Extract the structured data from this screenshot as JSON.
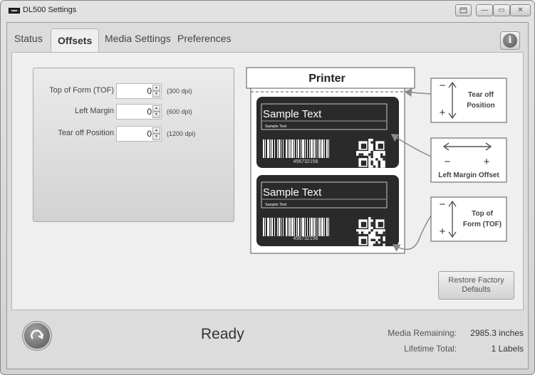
{
  "window": {
    "title": "DL500 Settings",
    "controls": {
      "minimize": "—",
      "maximize": "▭",
      "close": "✕"
    }
  },
  "tabs": [
    {
      "label": "Status",
      "active": false
    },
    {
      "label": "Offsets",
      "active": true
    },
    {
      "label": "Media Settings",
      "active": false
    },
    {
      "label": "Preferences",
      "active": false
    }
  ],
  "info_button": {
    "icon": "info-icon",
    "glyph": "i"
  },
  "offsets": {
    "fields": [
      {
        "label": "Top of Form (TOF)",
        "value": "0",
        "note": "(300 dpi)"
      },
      {
        "label": "Left Margin",
        "value": "0",
        "note": "(600 dpi)"
      },
      {
        "label": "Tear off Position",
        "value": "0",
        "note": "(1200 dpi)"
      }
    ]
  },
  "illustration": {
    "printer_label": "Printer",
    "labels": [
      {
        "title": "Sample Text",
        "subtitle": "Sample Text",
        "barcode_number": "456732156"
      },
      {
        "title": "Sample Text",
        "subtitle": "Sample Text",
        "barcode_number": "456732156"
      }
    ],
    "callouts": {
      "tear_off": {
        "line1": "Tear off",
        "line2": "Position",
        "minus": "−",
        "plus": "+"
      },
      "left_margin": {
        "label": "Left Margin Offset",
        "minus": "−",
        "plus": "+"
      },
      "tof": {
        "line1": "Top of",
        "line2": "Form (TOF)",
        "minus": "−",
        "plus": "+"
      }
    }
  },
  "restore_button": {
    "line1": "Restore Factory",
    "line2": "Defaults"
  },
  "status": {
    "state": "Ready",
    "media_remaining_label": "Media Remaining:",
    "media_remaining_value": "2985.3 inches",
    "lifetime_total_label": "Lifetime Total:",
    "lifetime_total_value": "1 Labels"
  },
  "colors": {
    "window_bg": "#dcdcdc",
    "panel_bg": "#efefef",
    "label_bg": "#2a2a2a",
    "callout_border": "#8c8c8c"
  }
}
